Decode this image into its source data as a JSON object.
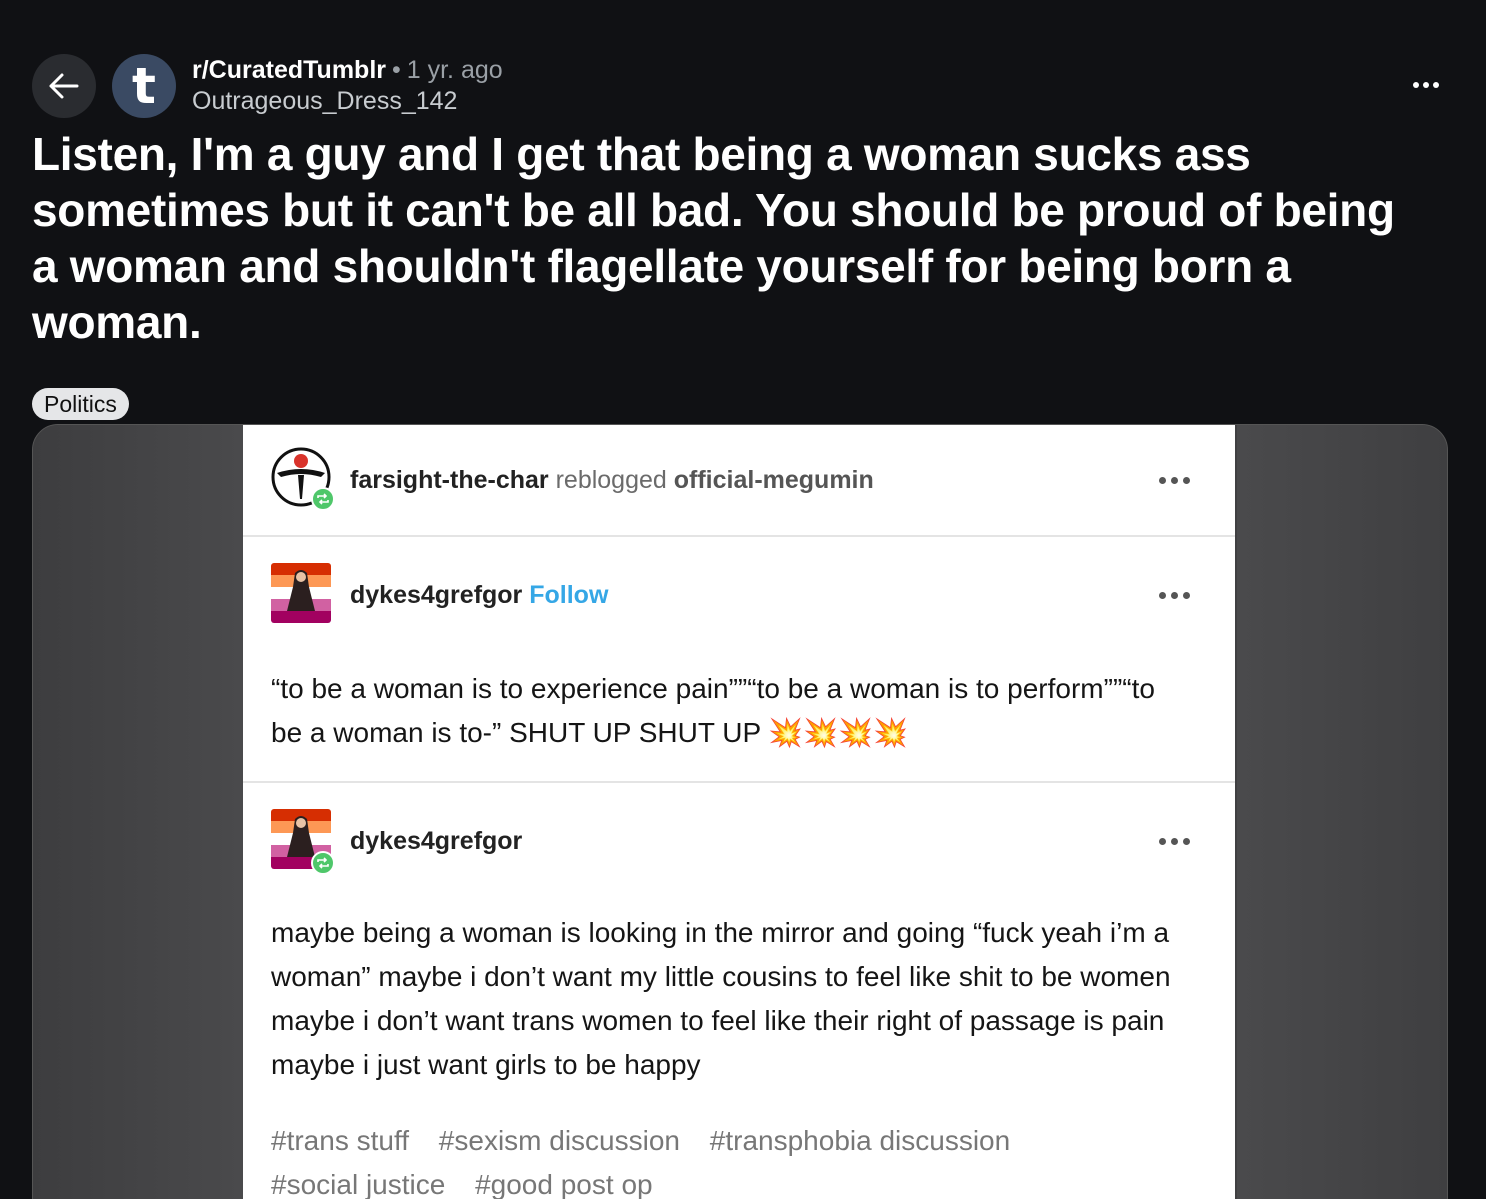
{
  "header": {
    "subreddit": "r/CuratedTumblr",
    "separator": "•",
    "time_ago": "1 yr. ago",
    "author": "Outrageous_Dress_142",
    "subreddit_icon_letter": "t"
  },
  "post": {
    "title": "Listen, I'm a guy and I get that being a woman sucks ass sometimes but it can't be all bad. You should be proud of being a woman and shouldn't flagellate yourself for being born a woman.",
    "flair": "Politics"
  },
  "tumblr": {
    "reblog": {
      "user": "farsight-the-char",
      "action": "reblogged",
      "source": "official-megumin"
    },
    "post1": {
      "user": "dykes4grefgor",
      "follow_label": "Follow",
      "text": "“to be a woman is to experience pain””“to be a woman is to perform””“to be a woman is to-” SHUT UP SHUT UP 💥💥💥💥"
    },
    "post2": {
      "user": "dykes4grefgor",
      "text": "maybe being a woman is looking in the mirror and going “fuck yeah i’m a woman” maybe i don’t want my little cousins to feel like shit to be women maybe i don’t want trans women to feel like their right of passage is pain maybe i just want girls to be happy",
      "tags": [
        "#trans stuff",
        "#sexism discussion",
        "#transphobia discussion",
        "#social justice",
        "#good post op"
      ]
    }
  },
  "colors": {
    "background": "#101114",
    "follow_link": "#35a7e6",
    "reblog_badge": "#4fc76a",
    "subreddit_icon_bg": "#3a4a63"
  }
}
